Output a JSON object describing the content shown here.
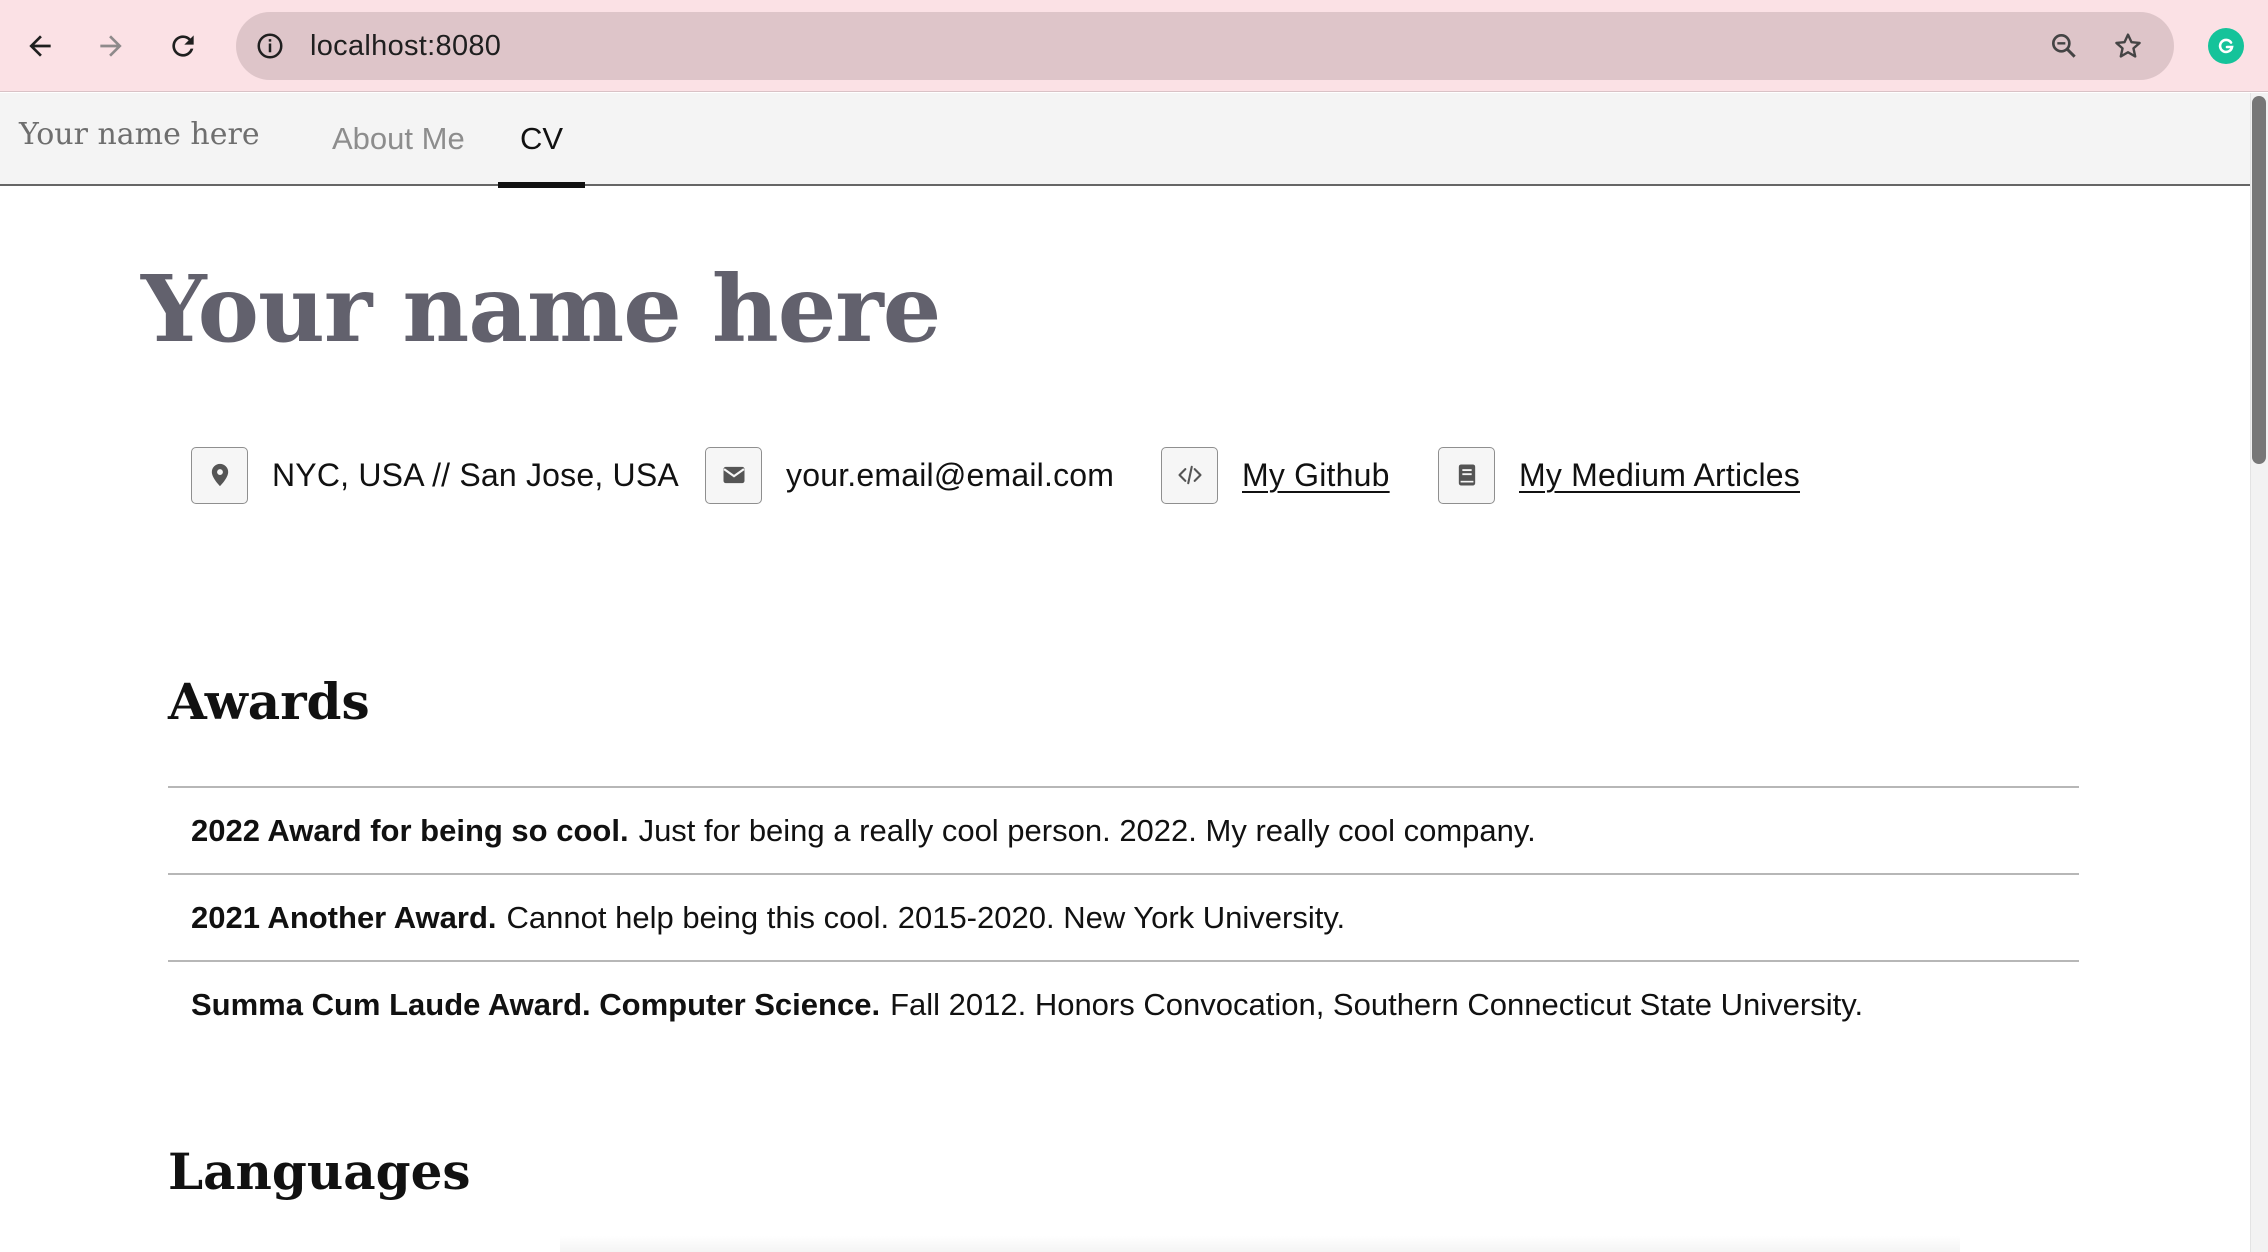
{
  "browser": {
    "url": "localhost:8080",
    "accent_color": "#fbe1e5"
  },
  "nav": {
    "brand": "Your name here",
    "tabs": [
      {
        "label": "About Me",
        "active": false
      },
      {
        "label": "CV",
        "active": true
      }
    ]
  },
  "page": {
    "title": "Your name here"
  },
  "contact": {
    "location": "NYC, USA // San Jose, USA",
    "email": "your.email@email.com",
    "github_label": "My Github",
    "medium_label": "My Medium Articles"
  },
  "awards": {
    "heading": "Awards",
    "items": [
      {
        "strong": "2022 Award for being so cool.",
        "rest": "Just for being a really cool person. 2022. My really cool company."
      },
      {
        "strong": "2021 Another Award.",
        "rest": "Cannot help being this cool. 2015-2020. New York University."
      },
      {
        "strong": "Summa Cum Laude Award. Computer Science.",
        "rest": "Fall 2012. Honors Convocation, Southern Connecticut State University."
      }
    ]
  },
  "languages": {
    "heading": "Languages"
  },
  "icons": [
    "back-arrow-icon",
    "forward-arrow-icon",
    "reload-icon",
    "site-info-icon",
    "zoom-icon",
    "star-icon",
    "grammarly-icon",
    "location-pin-icon",
    "envelope-icon",
    "code-icon",
    "book-icon"
  ]
}
